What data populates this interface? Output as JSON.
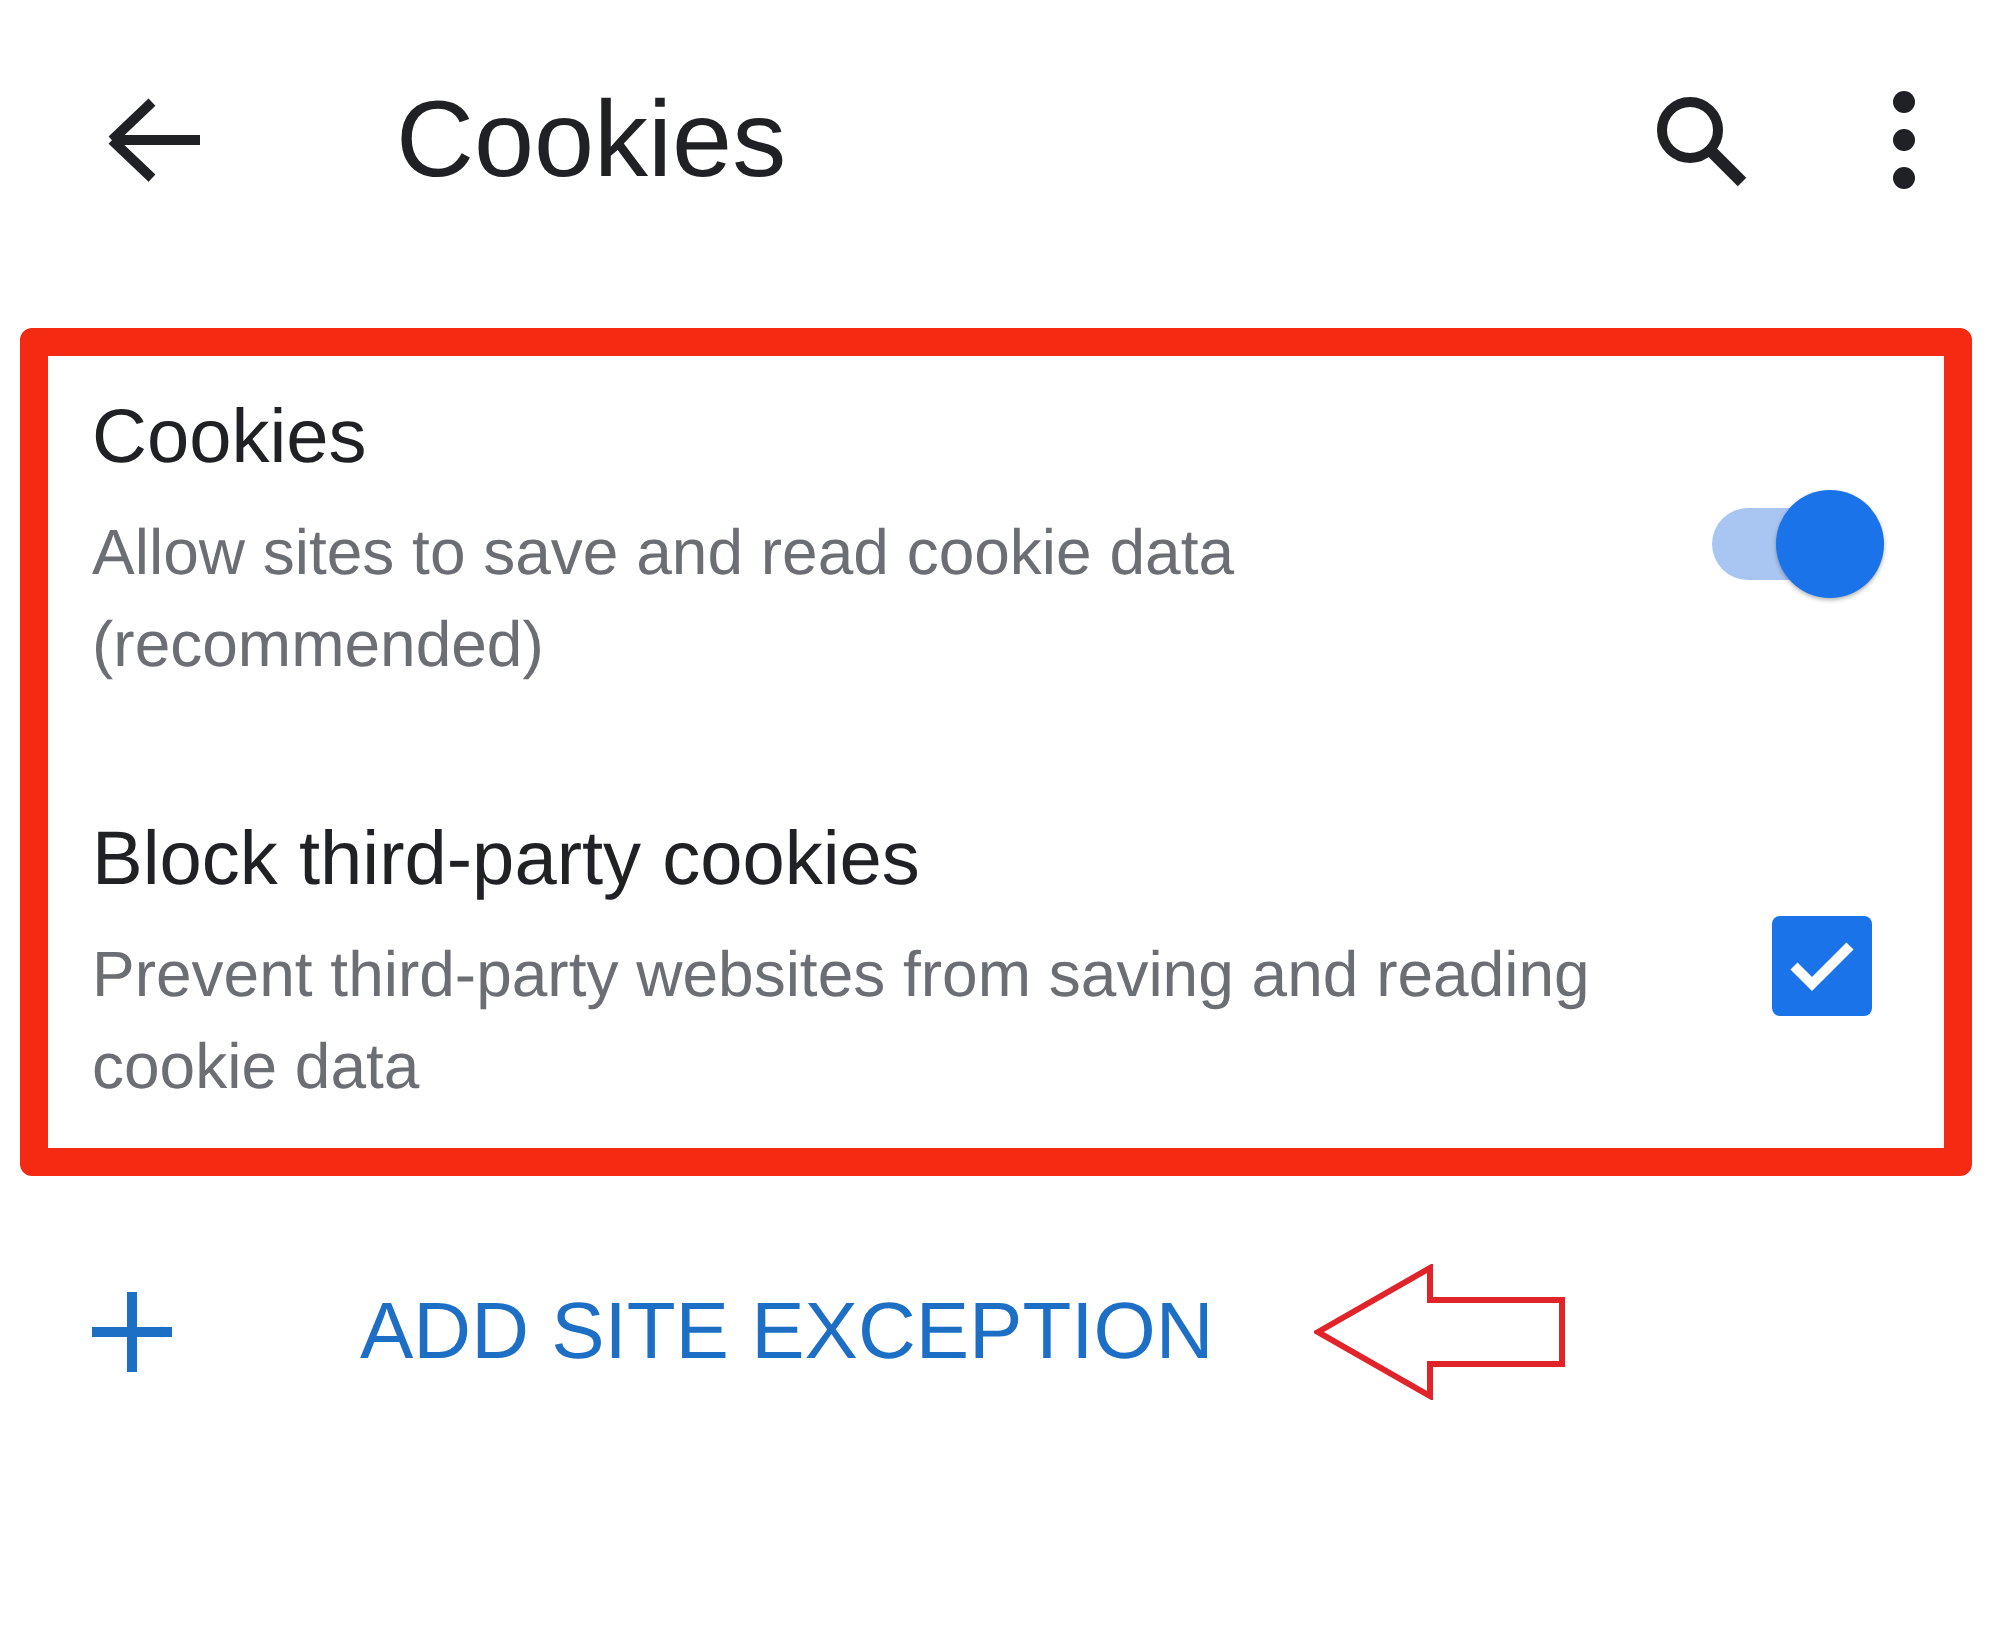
{
  "app_bar": {
    "title": "Cookies"
  },
  "settings": [
    {
      "kind": "toggle",
      "title": "Cookies",
      "description": "Allow sites to save and read cookie data (recommended)",
      "on": true
    },
    {
      "kind": "checkbox",
      "title": "Block third-party cookies",
      "description": "Prevent third-party websites from saving and reading cookie data",
      "checked": true
    }
  ],
  "action": {
    "label": "ADD SITE EXCEPTION"
  }
}
